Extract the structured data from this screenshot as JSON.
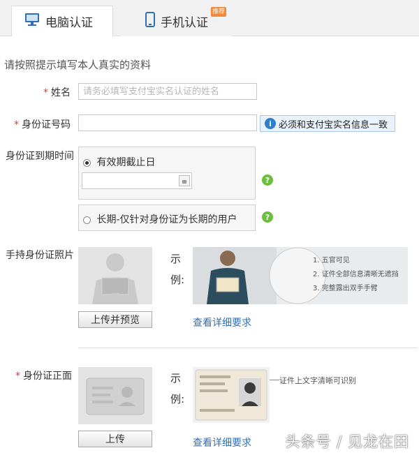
{
  "tabs": {
    "pc_label": "电脑认证",
    "mobile_label": "手机认证",
    "mobile_badge": "推荐"
  },
  "intro": "请按照提示填写本人真实的资料",
  "name_field": {
    "label": "姓名",
    "placeholder": "请务必填写支付宝实名认证的姓名"
  },
  "id_number": {
    "label": "身份证号码",
    "hint": "必须和支付宝实名信息一致"
  },
  "expiry": {
    "label": "身份证到期时间",
    "option_date": "有效期截止日",
    "option_long": "长期-仅针对身份证为长期的用户"
  },
  "handheld": {
    "label": "手持身份证照片",
    "upload_button": "上传并预览",
    "example_label_1": "示",
    "example_label_2": "例:",
    "requirements": [
      "1. 五官可见",
      "2. 证件全部信息清晰无遮挡",
      "3. 完整露出双手手臂"
    ],
    "detail_link": "查看详细要求"
  },
  "id_front": {
    "label": "身份证正面",
    "upload_button": "上传",
    "example_label_1": "示",
    "example_label_2": "例:",
    "annotation": "证件上文字清晰可识别",
    "detail_link": "查看详细要求"
  },
  "watermark": "头条号 / 见龙在田",
  "colors": {
    "required_star": "#e0393e",
    "link": "#2f6fba",
    "hint_bg": "#eaf3fc",
    "help_icon": "#6cbf3a"
  }
}
